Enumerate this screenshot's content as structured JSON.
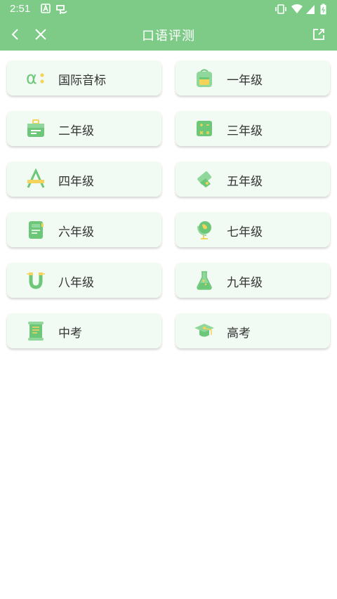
{
  "status_bar": {
    "time": "2:51"
  },
  "app_bar": {
    "title": "口语评测"
  },
  "categories": [
    {
      "label": "国际音标",
      "icon": "alpha-phonetic-icon"
    },
    {
      "label": "一年级",
      "icon": "backpack-icon"
    },
    {
      "label": "二年级",
      "icon": "briefcase-icon"
    },
    {
      "label": "三年级",
      "icon": "calculator-icon"
    },
    {
      "label": "四年级",
      "icon": "letter-a-icon"
    },
    {
      "label": "五年级",
      "icon": "eraser-icon"
    },
    {
      "label": "六年级",
      "icon": "notebook-icon"
    },
    {
      "label": "七年级",
      "icon": "globe-icon"
    },
    {
      "label": "八年级",
      "icon": "magnet-icon"
    },
    {
      "label": "九年级",
      "icon": "flask-icon"
    },
    {
      "label": "中考",
      "icon": "scroll-icon"
    },
    {
      "label": "高考",
      "icon": "graduation-cap-icon"
    }
  ],
  "colors": {
    "primary": "#7dcb87",
    "card_bg": "#f2fbf3",
    "icon_green": "#6cc779",
    "icon_yellow": "#f3d35a"
  }
}
